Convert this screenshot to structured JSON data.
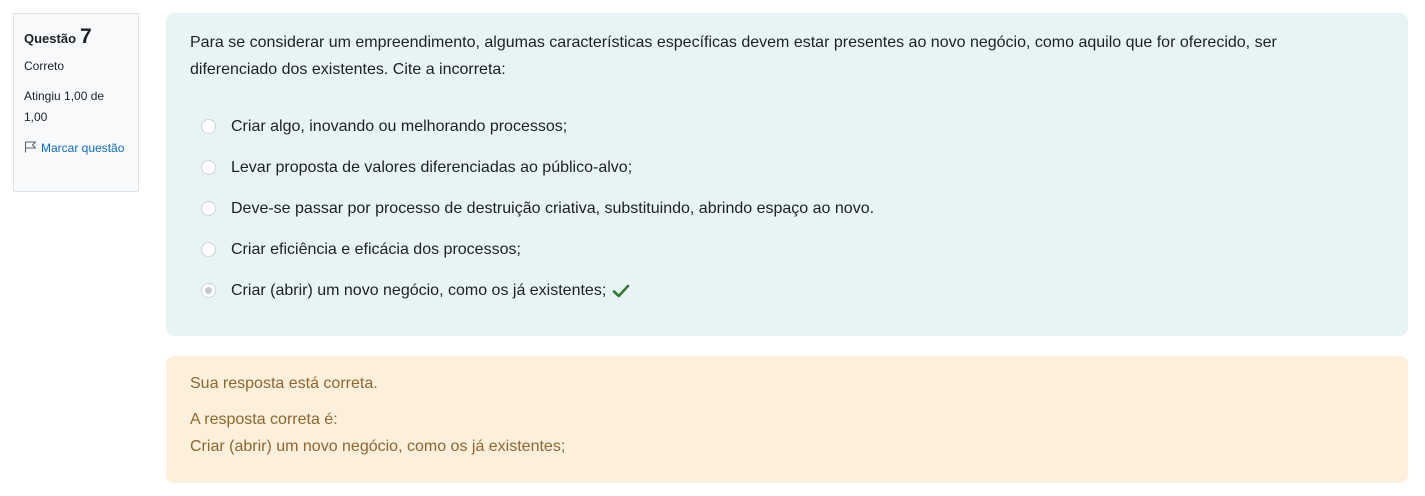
{
  "info": {
    "question_label": "Questão",
    "question_number": "7",
    "state": "Correto",
    "grade": "Atingiu 1,00 de 1,00",
    "flag_label": "Marcar questão"
  },
  "question": {
    "text": "Para se considerar um empreendimento, algumas características específicas devem estar presentes ao novo negócio, como aquilo que for oferecido, ser diferenciado dos existentes.  Cite a incorreta:",
    "options": [
      {
        "label": "Criar algo, inovando ou melhorando processos;",
        "selected": false
      },
      {
        "label": "Levar proposta de valores diferenciadas ao público-alvo;",
        "selected": false
      },
      {
        "label": "Deve-se passar por processo de destruição criativa, substituindo, abrindo espaço ao novo.",
        "selected": false
      },
      {
        "label": "Criar eficiência e eficácia dos processos;",
        "selected": false
      },
      {
        "label": "Criar (abrir) um novo negócio, como os já existentes;",
        "selected": true
      }
    ]
  },
  "outcome": {
    "feedback": "Sua resposta está correta.",
    "right_answer_label": "A resposta correta é:",
    "right_answer": "Criar (abrir) um novo negócio, como os já existentes;"
  },
  "icons": {
    "flag": "flag-icon",
    "correct": "check-icon"
  },
  "colors": {
    "correct": "#357a32",
    "link": "#0f6cbf",
    "feedback_text": "#8e662e"
  }
}
